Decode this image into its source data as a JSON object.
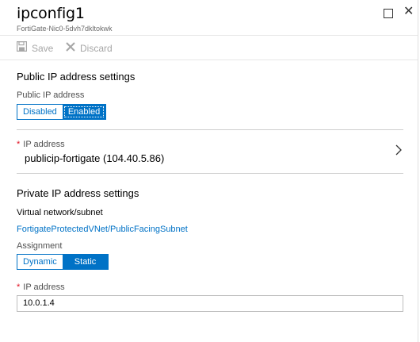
{
  "header": {
    "title": "ipconfig1",
    "subtitle": "FortiGate-Nic0-5dvh7dkltokwk"
  },
  "window_controls": {
    "maximize_icon": "square-outline",
    "close_icon": "x-close"
  },
  "toolbar": {
    "save_label": "Save",
    "discard_label": "Discard"
  },
  "public": {
    "section_title": "Public IP address settings",
    "toggle_label": "Public IP address",
    "options": [
      "Disabled",
      "Enabled"
    ],
    "selected": "Enabled",
    "ip_label": "IP address",
    "ip_value": "publicip-fortigate (104.40.5.86)"
  },
  "private": {
    "section_title": "Private IP address settings",
    "vnet_label": "Virtual network/subnet",
    "vnet_value": "FortigateProtectedVNet/PublicFacingSubnet",
    "assignment_label": "Assignment",
    "options": [
      "Dynamic",
      "Static"
    ],
    "selected": "Static",
    "ip_label": "IP address",
    "ip_value": "10.0.1.4"
  },
  "colors": {
    "accent": "#0072c6",
    "required": "#e00b1c",
    "disabled_text": "#a6a6a6"
  }
}
